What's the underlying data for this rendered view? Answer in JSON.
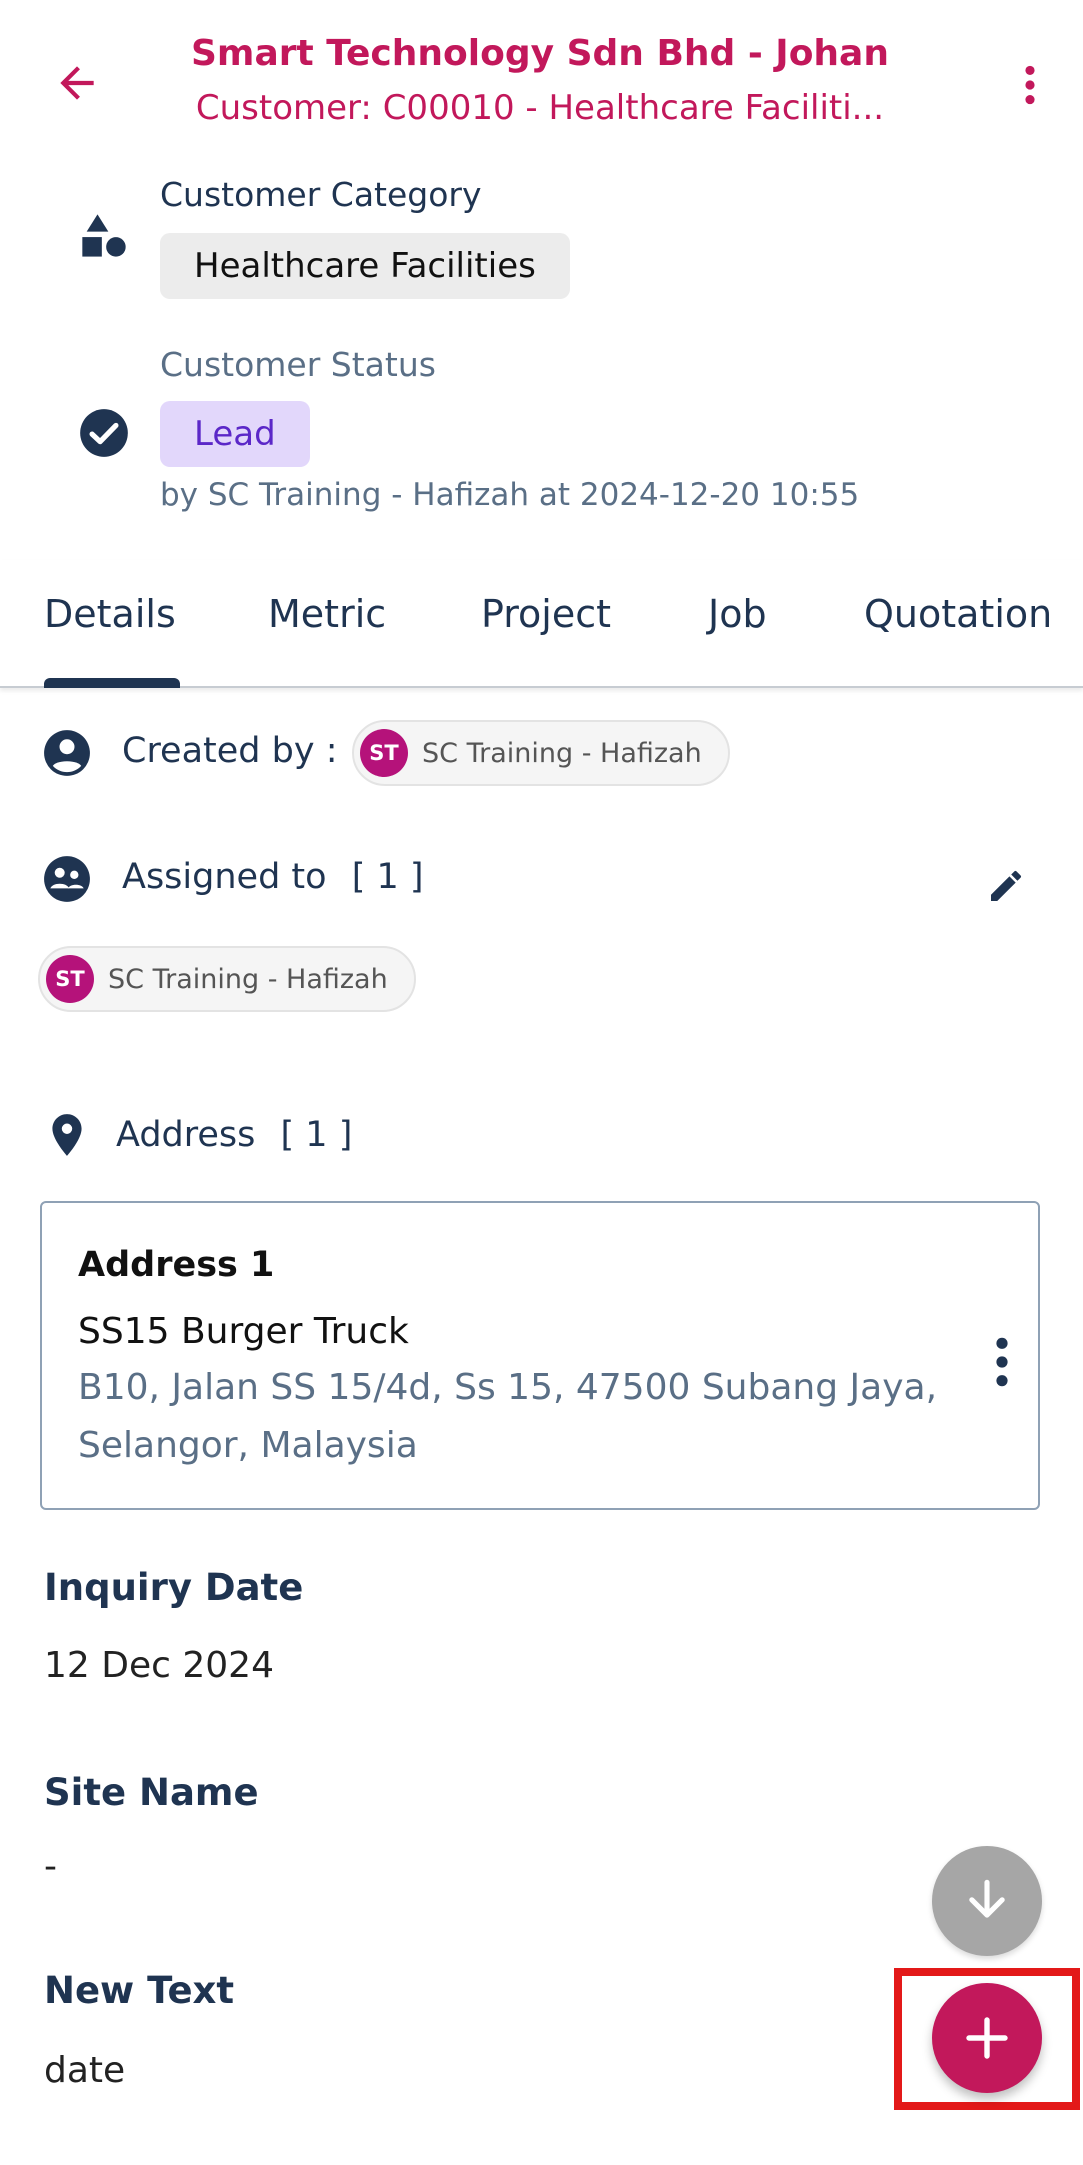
{
  "header": {
    "title": "Smart Technology Sdn Bhd - Johan",
    "subtitle": "Customer: C00010 - Healthcare Faciliti...",
    "accent_color": "#c2185b",
    "back_icon": "arrow-left-icon",
    "menu_icon": "more-vertical-icon"
  },
  "customer": {
    "category_label": "Customer Category",
    "category_value": "Healthcare Facilities",
    "status_label": "Customer Status",
    "status_value": "Lead",
    "status_byline": "by SC Training - Hafizah at 2024-12-20 10:55",
    "category_icon": "shapes-icon",
    "status_icon": "check-circle-icon"
  },
  "tabs": [
    {
      "label": "Details",
      "active": true
    },
    {
      "label": "Metric"
    },
    {
      "label": "Project"
    },
    {
      "label": "Job"
    },
    {
      "label": "Quotation"
    }
  ],
  "details": {
    "created_by_label": "Created by :",
    "created_by_user": {
      "initials": "ST",
      "name": "SC Training - Hafizah"
    },
    "assigned_label": "Assigned to",
    "assigned_count": "[ 1 ]",
    "assigned_users": [
      {
        "initials": "ST",
        "name": "SC Training - Hafizah"
      }
    ],
    "address_label": "Address",
    "address_count": "[ 1 ]",
    "addresses": [
      {
        "title": "Address 1",
        "name": "SS15 Burger Truck",
        "line1": "B10, Jalan SS 15/4d, Ss 15, 47500 Subang Jaya,",
        "line2": "Selangor, Malaysia"
      }
    ],
    "fields": [
      {
        "label": "Inquiry Date",
        "value": "12 Dec 2024"
      },
      {
        "label": "Site Name",
        "value": "-"
      },
      {
        "label": "New Text",
        "value": "date"
      }
    ]
  },
  "fabs": {
    "scroll_icon": "arrow-down-icon",
    "add_icon": "plus-icon"
  }
}
